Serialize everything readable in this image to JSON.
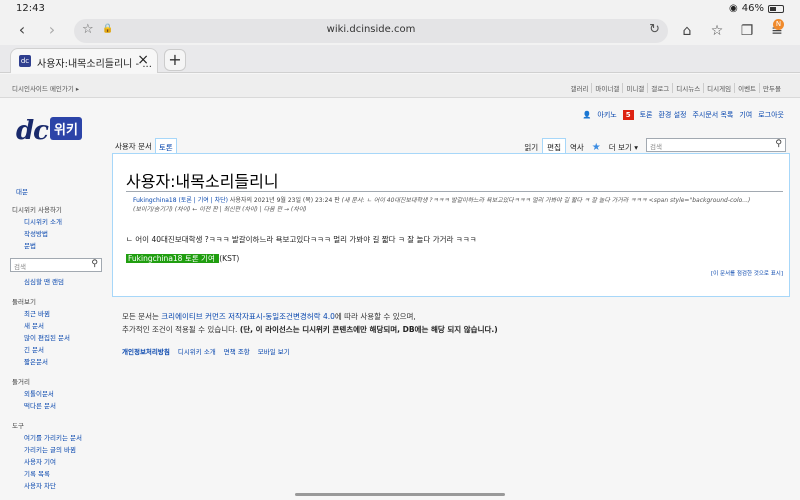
{
  "status": {
    "time": "12:43",
    "battery": "46%"
  },
  "browser": {
    "url": "wiki.dcinside.com",
    "tab_title": "사용자:내목소리들리니 - ...",
    "favicon": "dc",
    "notif": "N"
  },
  "dcbar": {
    "left": "디시인사이드 메인가기 ▸",
    "links": [
      "갤러리",
      "마이너갤",
      "미니갤",
      "갤로그",
      "디시뉴스",
      "디시게임",
      "이벤트",
      "만두몰"
    ]
  },
  "logo": {
    "dc": "dc",
    "wiki": "위키"
  },
  "usernav": {
    "user": "아키노",
    "alert": "5",
    "talk": "토론",
    "prefs": "환경 설정",
    "watchlist": "주시문서 목록",
    "contribs": "기여",
    "logout": "로그아웃"
  },
  "content_tabs": {
    "user_page": "사용자 문서",
    "talk": "토론",
    "read": "읽기",
    "edit": "편집",
    "history": "역사",
    "more": "더 보기 ▾"
  },
  "search": {
    "placeholder": "검색"
  },
  "sidebar": {
    "main_page": "대문",
    "use_heading": "디시위키 사용하기",
    "use_items": [
      "디시위키 소개",
      "작성방법",
      "문법"
    ],
    "search_placeholder": "검색",
    "random": "심심할 땐 랜덤",
    "browse_heading": "둘러보기",
    "browse_items": [
      "최근 바뀜",
      "새 문서",
      "많이 편집된 문서",
      "긴 문서",
      "짧은문서"
    ],
    "misc_heading": "둘거리",
    "misc_items": [
      "외톨이문서",
      "떡다른 문서"
    ],
    "tools_heading": "도구",
    "tools_items": [
      "여기를 가리키는 문서",
      "가리키는 글의 바뀜",
      "사용자 기여",
      "기록 목록",
      "사용자 차단"
    ]
  },
  "page": {
    "title": "사용자:내목소리들리니",
    "rev_user": "Fukingchina18",
    "rev_links": "(토론 | 기여 | 차단)",
    "rev_date": "사용자의 2021년 9월 23일 (목) 23:24 판",
    "rev_summary": "(새 문서: ㄴ 어이 40대진보대학생 ?ㅋㅋㅋ 발갈이하느라 욕보고있다ㅋㅋㅋ 멀리 가봐야 길 짧다 ㅋ 잘 놀다 가거라 ㅋㅋㅋ <span style=\"background-colo...)\n(보이기/숨기기) (차이) ← 이전 판 | 최신판 (차이) | 다음 판 → (차이)",
    "body": "ㄴ 어이 40대진보대학생 ?ㅋㅋㅋ 발갈이하느라 욕보고있다ㅋㅋㅋ 멀리 가봐야 길 짧다 ㅋ 잘 놀다 가거라 ㅋㅋㅋ",
    "sig_user": "Fukingchina18",
    "sig_talk": "토론",
    "sig_contrib": "기여",
    "sig_tz": "(KST)",
    "print_link": "[이 문서를 점검한 것으로 표시]"
  },
  "footer": {
    "line1_prefix": "모든 문서는 ",
    "license": "크리에이티브 커먼즈 저작자표시-동일조건변경허락 4.0",
    "line1_suffix": "에 따라 사용할 수 있으며,",
    "line2_prefix": "추가적인 조건이 적용될 수 있습니다. ",
    "line2_bold": "(단, 이 라이선스는 디시위키 콘텐츠에만 해당되며, DB에는 해당 되지 않습니다.)",
    "links": [
      "개인정보처리방침",
      "디시위키 소개",
      "면책 조항",
      "모바일 보기"
    ]
  },
  "colors": {
    "accent": "#0645ad",
    "sig_bg": "#209e10",
    "alert": "#dd1111",
    "logo": "#1a2a6c"
  }
}
